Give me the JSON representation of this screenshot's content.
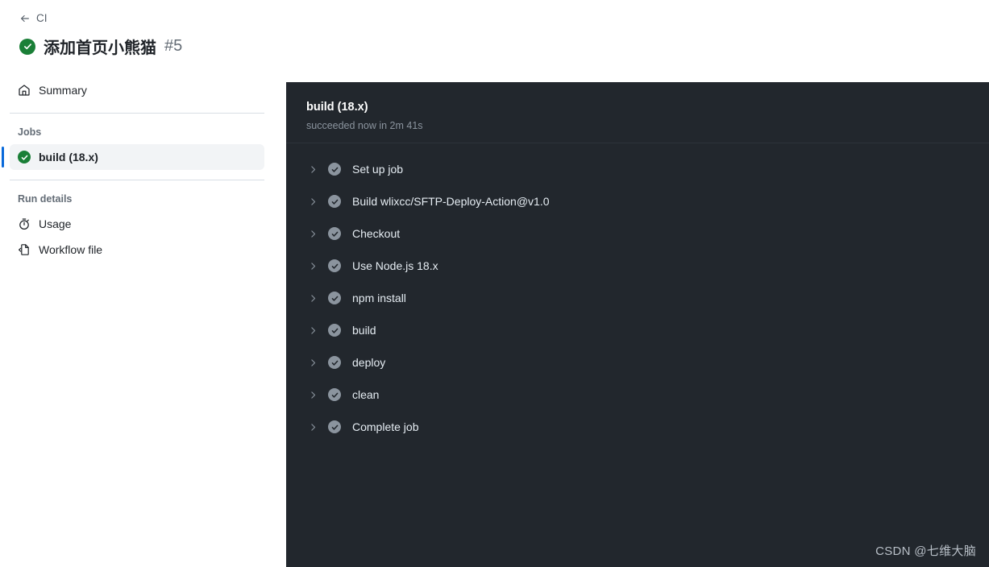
{
  "header": {
    "back_label": "CI",
    "back_icon": "arrow-left-icon",
    "status_icon": "check-circle-icon",
    "status_color": "#1a7f37",
    "title": "添加首页小熊猫",
    "run_number": "#5"
  },
  "sidebar": {
    "summary": {
      "label": "Summary",
      "icon": "home-icon"
    },
    "jobs_heading": "Jobs",
    "jobs": [
      {
        "label": "build (18.x)",
        "icon": "check-circle-icon",
        "selected": true,
        "status_color": "#1a7f37"
      }
    ],
    "run_details_heading": "Run details",
    "run_details": [
      {
        "label": "Usage",
        "icon": "stopwatch-icon"
      },
      {
        "label": "Workflow file",
        "icon": "file-code-icon"
      }
    ],
    "selected_accent": "#0969da",
    "selected_background": "#f2f4f6"
  },
  "log_panel": {
    "background": "#22272d",
    "job_name": "build (18.x)",
    "job_status": "succeeded now in 2m 41s",
    "chevron_icon": "chevron-right-icon",
    "step_status_icon": "check-circle-filled-icon",
    "step_status_color": "#8b949e",
    "steps": [
      {
        "label": "Set up job"
      },
      {
        "label": "Build wlixcc/SFTP-Deploy-Action@v1.0"
      },
      {
        "label": "Checkout"
      },
      {
        "label": "Use Node.js 18.x"
      },
      {
        "label": "npm install"
      },
      {
        "label": "build"
      },
      {
        "label": "deploy"
      },
      {
        "label": "clean"
      },
      {
        "label": "Complete job"
      }
    ]
  },
  "watermark": {
    "text": "CSDN @七维大脑"
  }
}
